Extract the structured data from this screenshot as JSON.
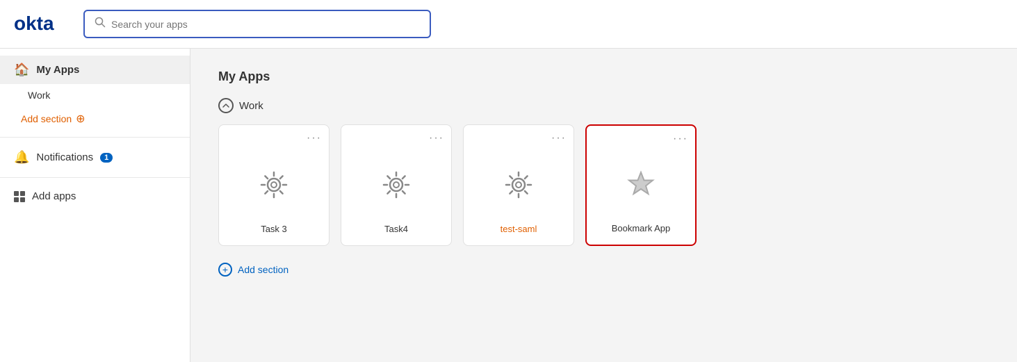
{
  "header": {
    "logo_text": "okta",
    "search_placeholder": "Search your apps",
    "search_value": ""
  },
  "sidebar": {
    "my_apps_label": "My Apps",
    "work_label": "Work",
    "add_section_label": "Add section",
    "notifications_label": "Notifications",
    "notifications_count": "1",
    "add_apps_label": "Add apps"
  },
  "main": {
    "section_heading": "My Apps",
    "work_section_label": "Work",
    "apps": [
      {
        "id": "task3",
        "label": "Task 3",
        "type": "gear",
        "link_style": false,
        "highlighted": false
      },
      {
        "id": "task4",
        "label": "Task4",
        "type": "gear",
        "link_style": false,
        "highlighted": false
      },
      {
        "id": "test-saml",
        "label": "test-saml",
        "type": "gear",
        "link_style": true,
        "highlighted": false
      },
      {
        "id": "bookmark-app",
        "label": "Bookmark App",
        "type": "star",
        "link_style": false,
        "highlighted": true
      }
    ],
    "add_section_label": "Add section",
    "menu_dots": "···"
  },
  "colors": {
    "accent_blue": "#0062c0",
    "accent_orange": "#e05f00",
    "highlight_red": "#cc0000",
    "search_border": "#3a5bbf"
  }
}
